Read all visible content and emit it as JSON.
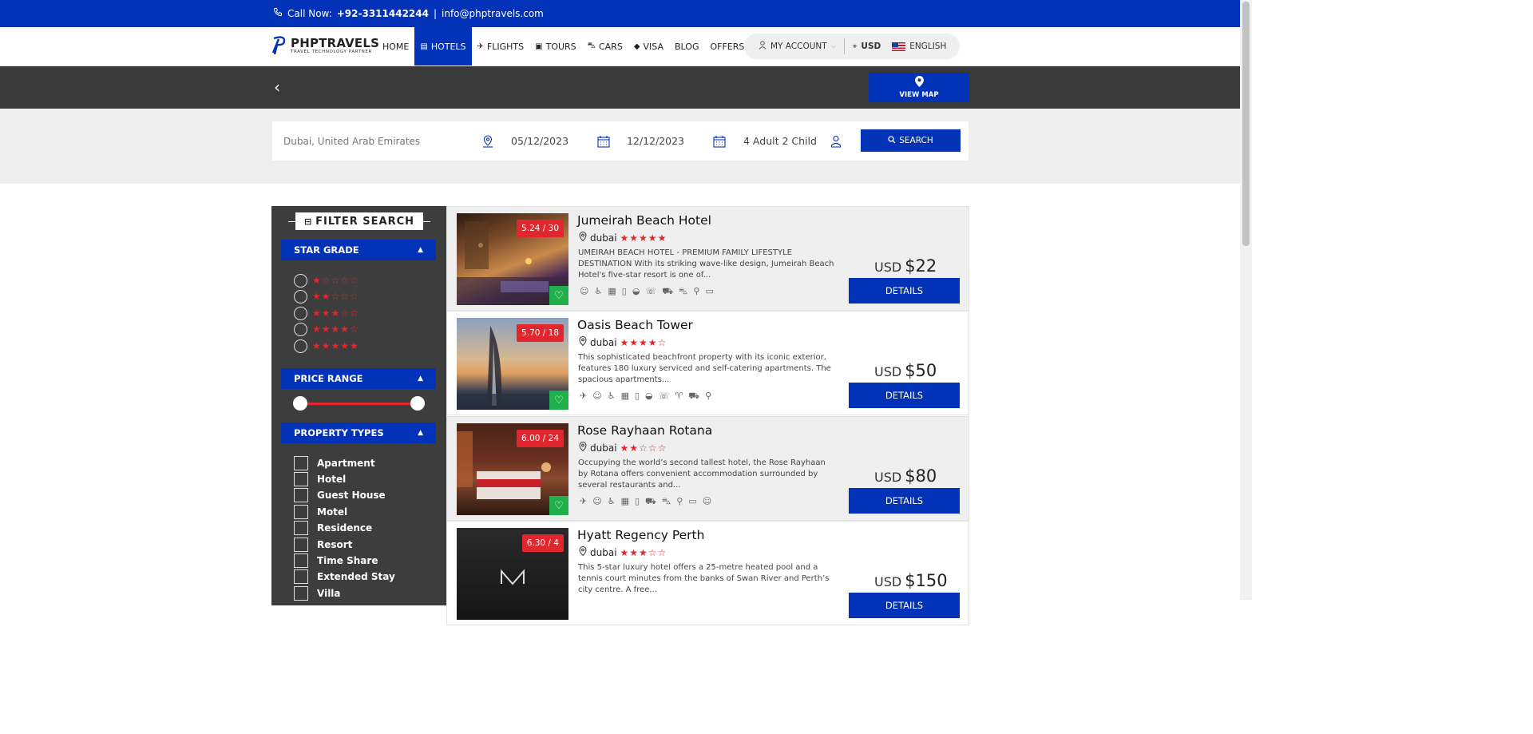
{
  "topbar": {
    "call_label": "Call Now:",
    "phone": "+92-3311442244",
    "sep": "|",
    "email": "info@phptravels.com"
  },
  "logo": {
    "name": "PHPTRAVELS",
    "tagline": "TRAVEL TECHNOLOGY PARTNER"
  },
  "menu": [
    {
      "label": "HOME",
      "icon": ""
    },
    {
      "label": "HOTELS",
      "icon": "building-icon"
    },
    {
      "label": "FLIGHTS",
      "icon": "plane-icon"
    },
    {
      "label": "TOURS",
      "icon": "suitcase-icon"
    },
    {
      "label": "CARS",
      "icon": "car-icon"
    },
    {
      "label": "VISA",
      "icon": "tag-icon"
    },
    {
      "label": "BLOG",
      "icon": ""
    },
    {
      "label": "OFFERS",
      "icon": ""
    }
  ],
  "account": {
    "label": "MY ACCOUNT",
    "currency": "USD",
    "language": "ENGLISH"
  },
  "band": {
    "view_map": "VIEW MAP"
  },
  "search": {
    "destination": "Dubai, United Arab Emirates",
    "checkin": "05/12/2023",
    "checkout": "12/12/2023",
    "guests": "4 Adult 2 Child",
    "button": "SEARCH"
  },
  "filters": {
    "title": "FILTER SEARCH",
    "star_grade": "STAR GRADE",
    "star_options": [
      "★☆☆☆☆",
      "★★☆☆☆",
      "★★★☆☆",
      "★★★★☆",
      "★★★★★"
    ],
    "price_range": "PRICE RANGE",
    "property_types": "PROPERTY TYPES",
    "property_options": [
      "Apartment",
      "Hotel",
      "Guest House",
      "Motel",
      "Residence",
      "Resort",
      "Time Share",
      "Extended Stay",
      "Villa"
    ]
  },
  "hotels": [
    {
      "name": "Jumeirah Beach Hotel",
      "rating": "5.24 / 30",
      "location": "dubai",
      "stars": "★★★★★",
      "desc": "UMEIRAH BEACH HOTEL - PREMIUM FAMILY LIFESTYLE DESTINATION With its striking wave-like design, Jumeirah Beach Hotel's five-star resort is one of...",
      "currency": "USD",
      "price": "$22",
      "details": "DETAILS"
    },
    {
      "name": "Oasis Beach Tower",
      "rating": "5.70 / 18",
      "location": "dubai",
      "stars": "★★★★☆",
      "desc": "This sophisticated beachfront property with its iconic exterior, features 180 luxury serviced and self-catering apartments. The spacious apartments...",
      "currency": "USD",
      "price": "$50",
      "details": "DETAILS"
    },
    {
      "name": "Rose Rayhaan Rotana",
      "rating": "6.00 / 24",
      "location": "dubai",
      "stars": "★★☆☆☆",
      "desc": "Occupying the world’s second tallest hotel, the Rose Rayhaan by Rotana offers convenient accommodation surrounded by several restaurants and...",
      "currency": "USD",
      "price": "$80",
      "details": "DETAILS"
    },
    {
      "name": "Hyatt Regency Perth",
      "rating": "6.30 / 4",
      "location": "dubai",
      "stars": "★★★☆☆",
      "desc": "This 5-star luxury hotel offers a 25-metre heated pool and a tennis court minutes from the banks of Swan River and Perth’s city centre. A free...",
      "currency": "USD",
      "price": "$150",
      "details": "DETAILS"
    }
  ],
  "colors": {
    "brand": "#0132b8",
    "accent": "#e3262d",
    "fav": "#1fb04b"
  }
}
